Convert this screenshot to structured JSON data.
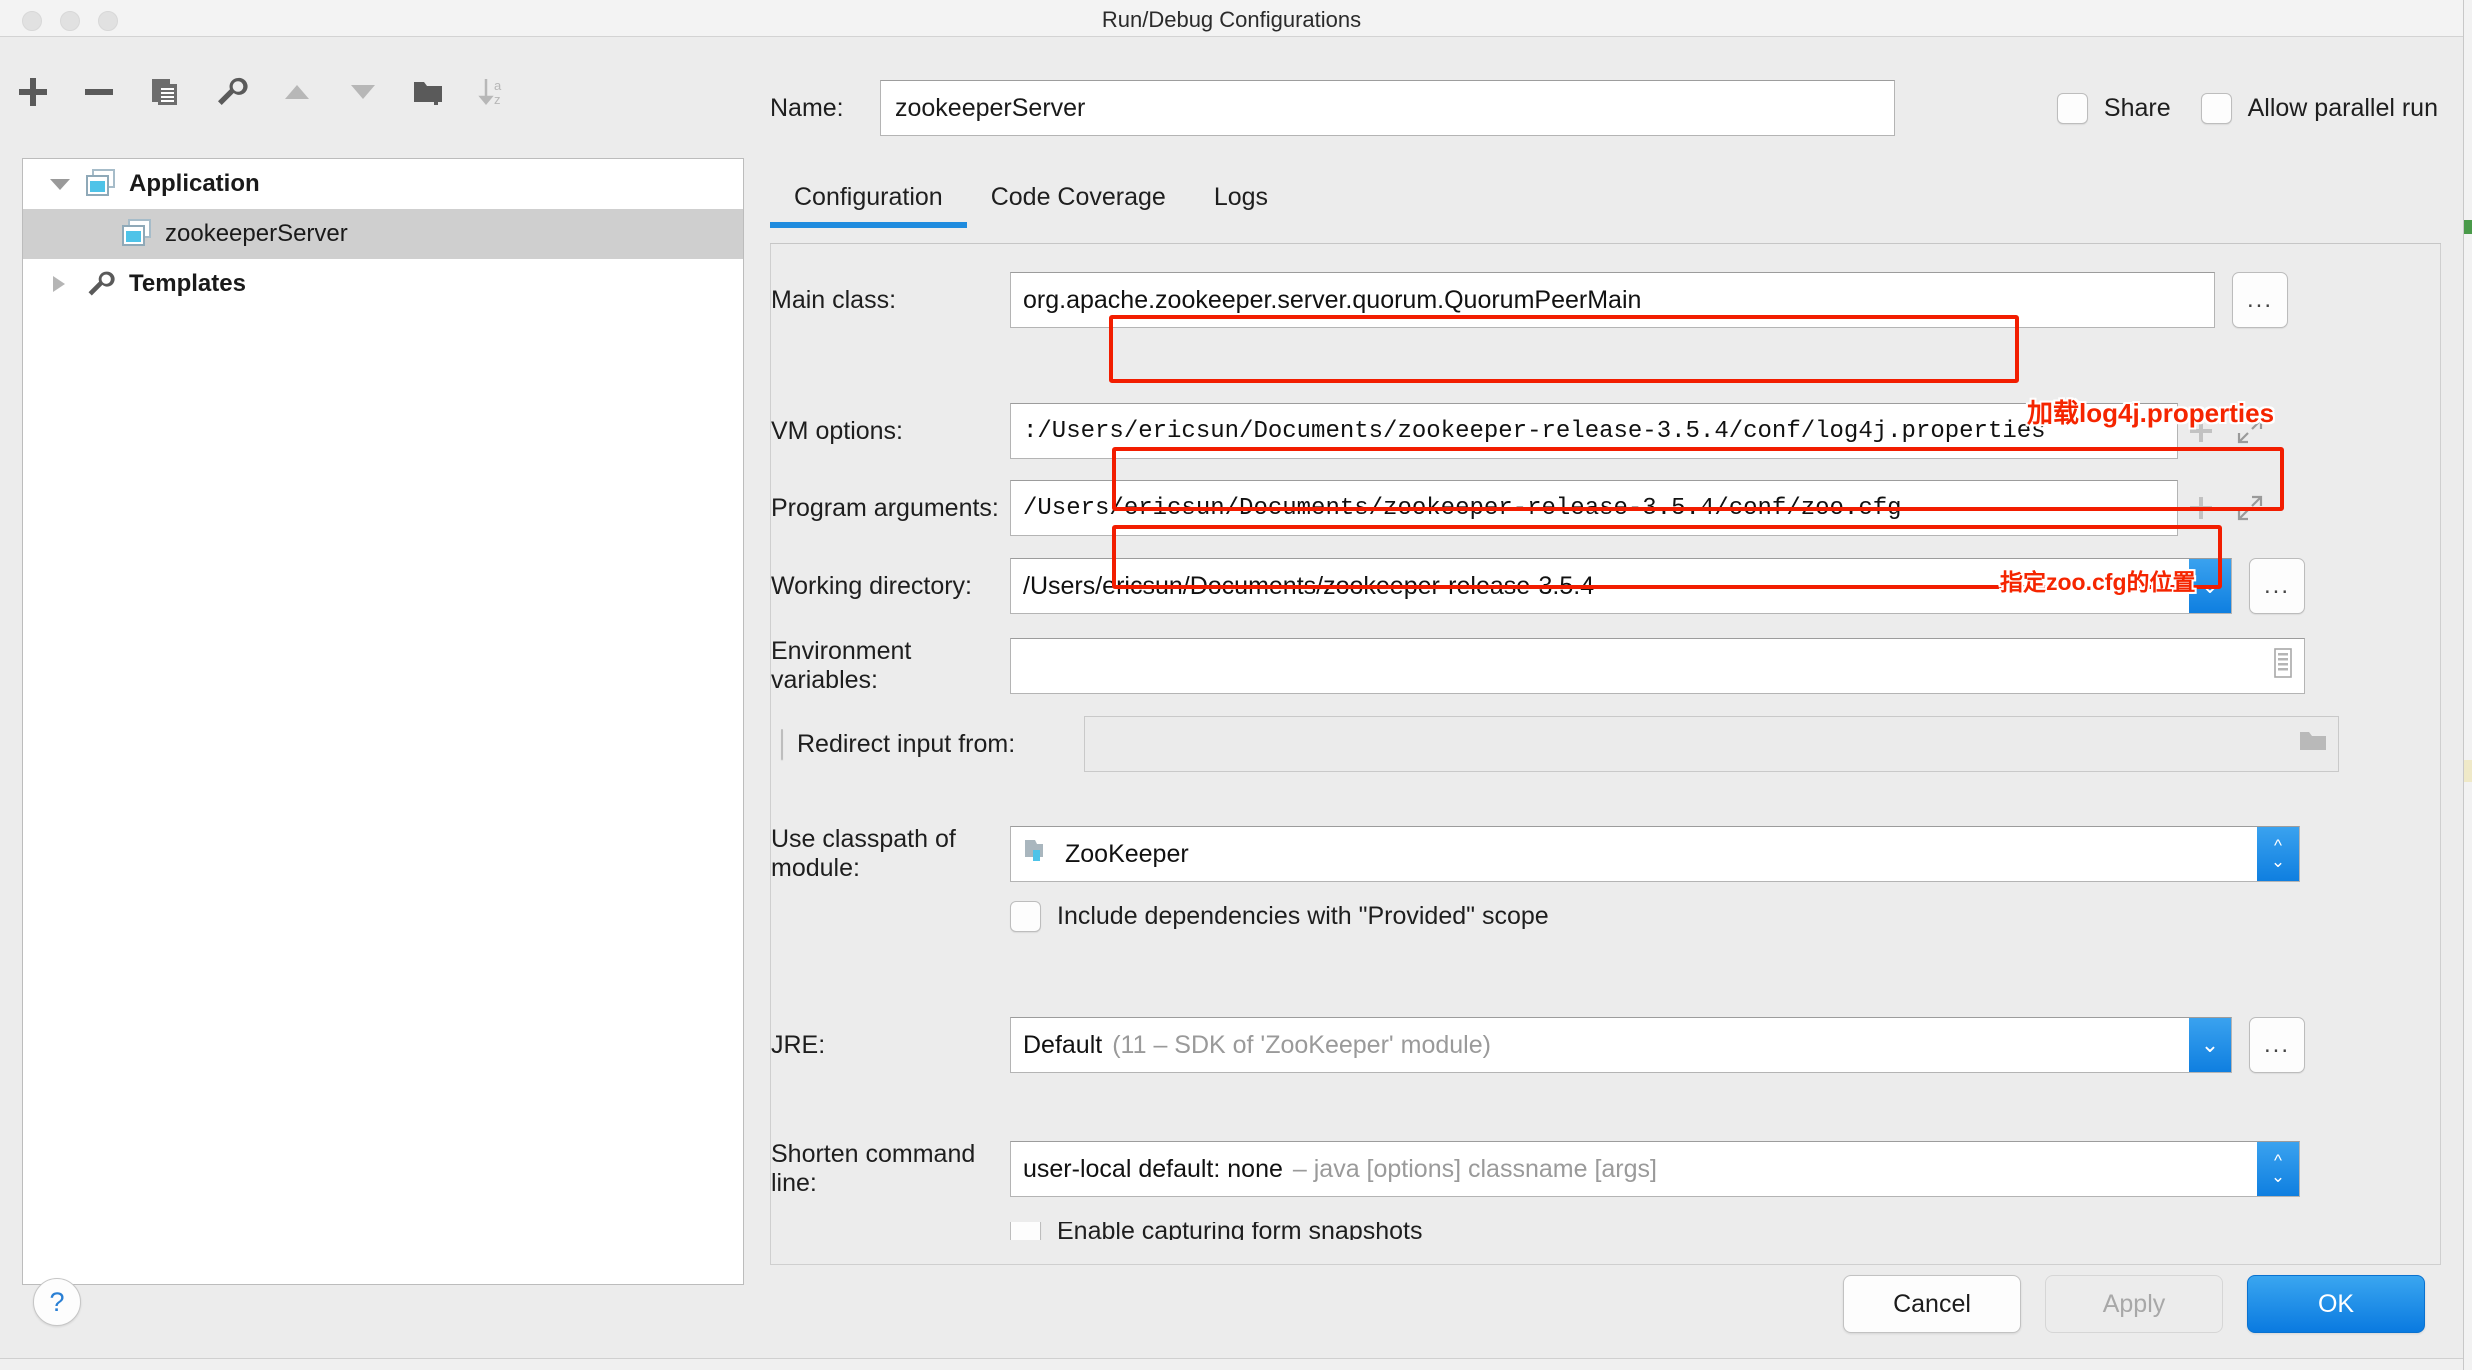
{
  "window": {
    "title": "Run/Debug Configurations",
    "traffic_lights": [
      "close",
      "minimize",
      "zoom"
    ]
  },
  "toolbar": {
    "buttons": [
      {
        "name": "add-icon",
        "label": "+"
      },
      {
        "name": "remove-icon",
        "label": "−"
      },
      {
        "name": "copy-configuration-icon",
        "label": "copy"
      },
      {
        "name": "edit-templates-wrench-icon",
        "label": "wrench"
      },
      {
        "name": "move-up-icon",
        "label": "up"
      },
      {
        "name": "move-down-icon",
        "label": "down"
      },
      {
        "name": "new-folder-icon",
        "label": "folder+"
      },
      {
        "name": "sort-alphabetically-icon",
        "label": "sort-az"
      }
    ]
  },
  "tree": {
    "items": [
      {
        "label": "Application",
        "icon": "application-icon",
        "expanded": true,
        "selected": false,
        "level": 0
      },
      {
        "label": "zookeeperServer",
        "icon": "application-icon",
        "selected": true,
        "level": 1
      },
      {
        "label": "Templates",
        "icon": "wrench-icon",
        "expanded": false,
        "selected": false,
        "level": 0
      }
    ]
  },
  "header": {
    "name_label": "Name:",
    "name_value": "zookeeperServer",
    "name_placeholder": "",
    "share_label": "Share",
    "share_checked": false,
    "allow_parallel_label": "Allow parallel run",
    "allow_parallel_checked": false
  },
  "tabs": [
    {
      "label": "Configuration",
      "active": true
    },
    {
      "label": "Code Coverage",
      "active": false
    },
    {
      "label": "Logs",
      "active": false
    }
  ],
  "form": {
    "main_class": {
      "label": "Main class:",
      "value": "org.apache.zookeeper.server.quorum.QuorumPeerMain",
      "browse_label": "..."
    },
    "vm_options": {
      "label": "VM options:",
      "value": ":/Users/ericsun/Documents/zookeeper-release-3.5.4/conf/log4j.properties"
    },
    "program_arguments": {
      "label": "Program arguments:",
      "value": "/Users/ericsun/Documents/zookeeper-release-3.5.4/conf/zoo.cfg"
    },
    "working_directory": {
      "label": "Working directory:",
      "value": "/Users/ericsun/Documents/zookeeper-release-3.5.4",
      "browse_label": "..."
    },
    "environment_variables": {
      "label": "Environment variables:",
      "value": ""
    },
    "redirect_input": {
      "label": "Redirect input from:",
      "checked": false,
      "value": ""
    },
    "classpath_module": {
      "label": "Use classpath of module:",
      "value": "ZooKeeper"
    },
    "include_provided": {
      "label": "Include dependencies with \"Provided\" scope",
      "checked": false
    },
    "jre": {
      "label": "JRE:",
      "value": "Default",
      "value_detail": "(11 – SDK of 'ZooKeeper' module)",
      "browse_label": "..."
    },
    "shorten_command_line": {
      "label": "Shorten command line:",
      "value": "user-local default: none",
      "value_detail": "– java [options] classname [args]"
    },
    "form_snapshots": {
      "label": "Enable capturing form snapshots",
      "checked": false
    }
  },
  "annotations": [
    {
      "text": "加载log4j.properties",
      "color": "#f52500"
    },
    {
      "text": "指定zoo.cfg的位置",
      "color": "#f52500"
    }
  ],
  "footer": {
    "help_label": "?",
    "cancel_label": "Cancel",
    "apply_label": "Apply",
    "apply_enabled": false,
    "ok_label": "OK"
  },
  "colors": {
    "accent": "#1f8bde",
    "annotation_red": "#f21d00",
    "selection_gray": "#cfcfcf"
  }
}
